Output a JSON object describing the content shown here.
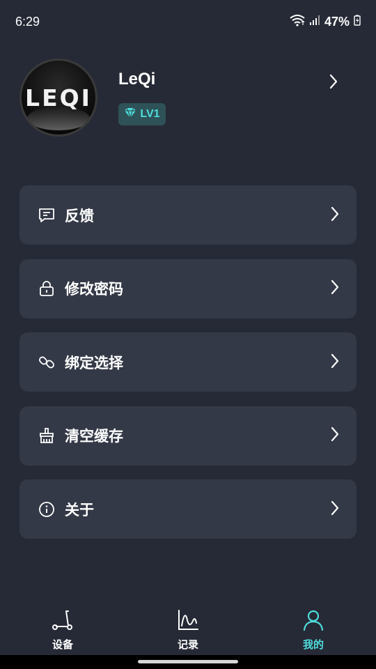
{
  "status": {
    "time": "6:29",
    "battery": "47%"
  },
  "profile": {
    "avatar_text": "LEQI",
    "name": "LeQi",
    "level": "LV1"
  },
  "menu": [
    {
      "label": "反馈",
      "icon": "feedback-icon"
    },
    {
      "label": "修改密码",
      "icon": "lock-icon"
    },
    {
      "label": "绑定选择",
      "icon": "link-icon"
    },
    {
      "label": "清空缓存",
      "icon": "broom-icon"
    },
    {
      "label": "关于",
      "icon": "info-icon"
    }
  ],
  "tabs": [
    {
      "label": "设备",
      "icon": "scooter-icon",
      "active": false
    },
    {
      "label": "记录",
      "icon": "chart-icon",
      "active": false
    },
    {
      "label": "我的",
      "icon": "person-icon",
      "active": true
    }
  ],
  "colors": {
    "background": "#262a36",
    "card": "#343947",
    "accent": "#4fdcdc",
    "badge_bg": "#2e5257"
  }
}
